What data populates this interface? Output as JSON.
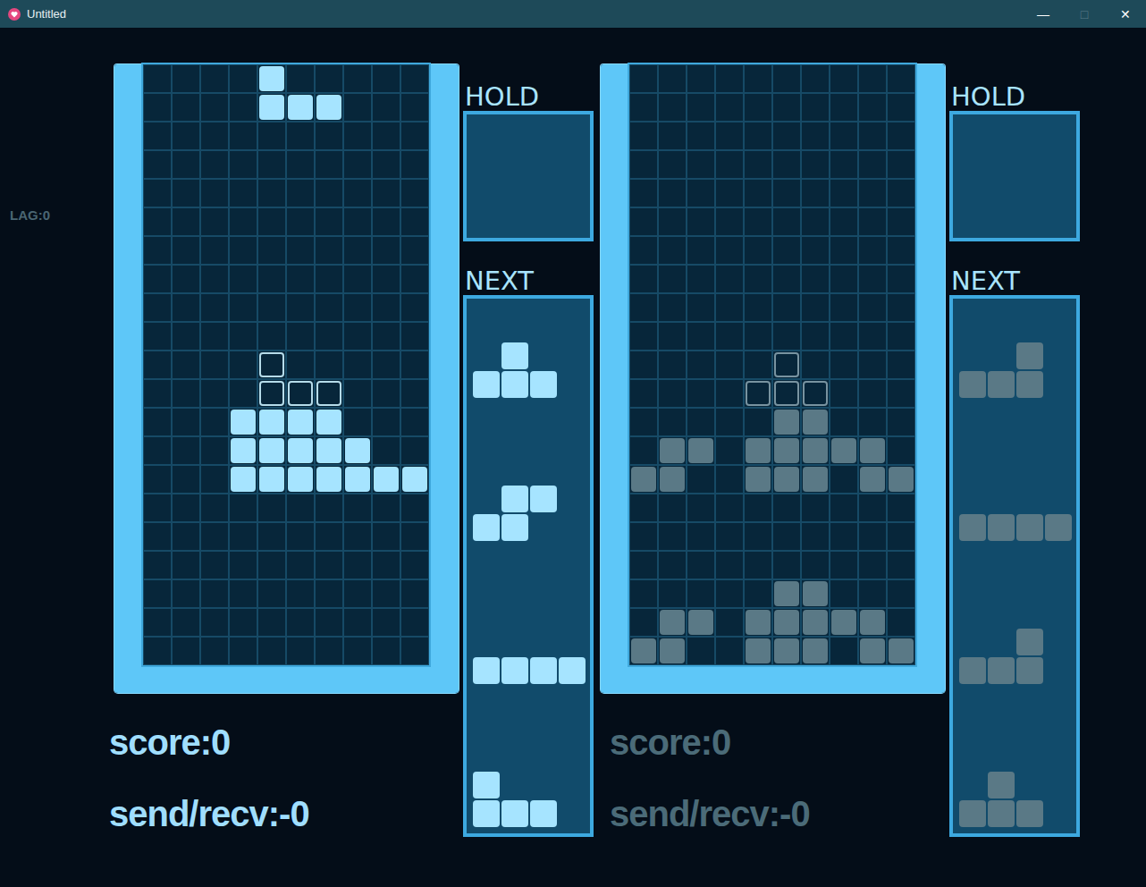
{
  "window": {
    "title": "Untitled",
    "controls": [
      {
        "glyph": "—",
        "disabled": false
      },
      {
        "glyph": "□",
        "disabled": true
      },
      {
        "glyph": "✕",
        "disabled": false
      }
    ]
  },
  "lag": "LAG:0",
  "players": [
    {
      "focused": true,
      "hold_label": "HOLD",
      "hold": [],
      "next_label": "NEXT",
      "next": [
        {
          "cells": [
            "010",
            "111"
          ]
        },
        {
          "cells": [
            "011",
            "110"
          ]
        },
        {
          "cells": [
            "1111"
          ]
        },
        {
          "cells": [
            "100",
            "111"
          ]
        }
      ],
      "board": [
        "....a.....",
        "....aaa...",
        "..........",
        "..........",
        "..........",
        "..........",
        "..........",
        "..........",
        "..........",
        "..........",
        "....g.....",
        "....ggg...",
        "...xxxx...",
        "...xxxxx..",
        "...xxxxxxx",
        "..........",
        "..........",
        "..........",
        "..........",
        "..........",
        ".........."
      ],
      "score": "score:0",
      "sendrecv": "send/recv:-0"
    },
    {
      "focused": false,
      "hold_label": "HOLD",
      "hold": [],
      "next_label": "NEXT",
      "next": [
        {
          "cells": [
            "001",
            "111"
          ]
        },
        {
          "cells": [
            "1111"
          ]
        },
        {
          "cells": [
            "001",
            "111"
          ]
        },
        {
          "cells": [
            "010",
            "111"
          ]
        }
      ],
      "board": [
        "..........",
        "..........",
        "..........",
        "..........",
        "..........",
        "..........",
        "..........",
        "..........",
        "..........",
        "..........",
        ".....g....",
        "....ggg...",
        ".....xx...",
        ".xx.xxxxx.",
        "xx..xxx.xx",
        "..........",
        "..........",
        "..........",
        ".....xx...",
        ".xx.xxxxx.",
        "xx..xxx.xx"
      ],
      "score": "score:0",
      "sendrecv": "send/recv:-0"
    }
  ]
}
